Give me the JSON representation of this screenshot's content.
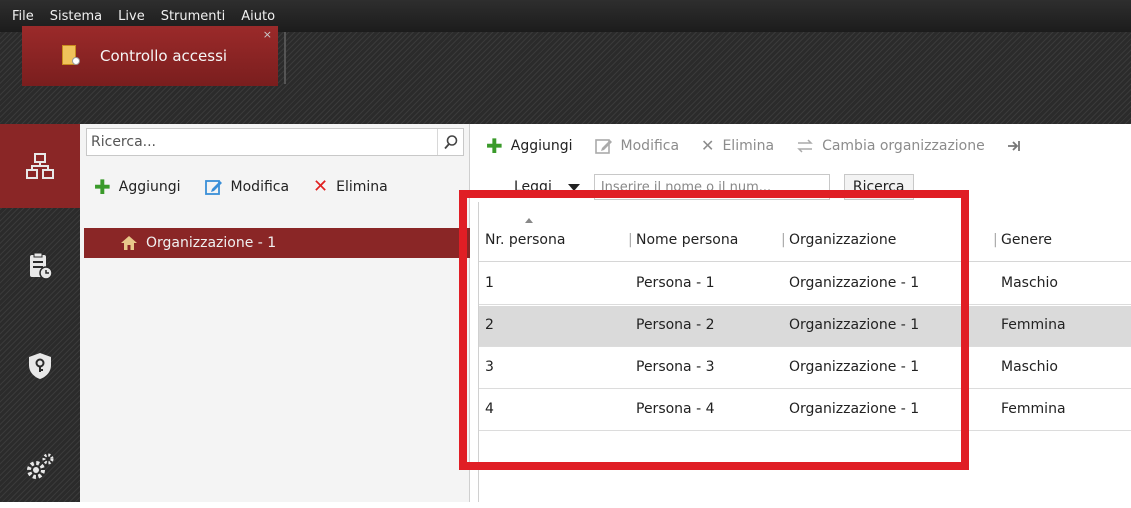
{
  "menu": [
    "File",
    "Sistema",
    "Live",
    "Strumenti",
    "Aiuto"
  ],
  "tab": {
    "label": "Controllo accessi",
    "close": "×"
  },
  "left": {
    "search_placeholder": "Ricerca...",
    "toolbar": {
      "add": "Aggiungi",
      "edit": "Modifica",
      "delete": "Elimina"
    },
    "tree": [
      {
        "label": "Organizzazione - 1"
      }
    ]
  },
  "right": {
    "toolbar": {
      "add": "Aggiungi",
      "edit": "Modifica",
      "delete": "Elimina",
      "change_org": "Cambia organizzazione"
    },
    "filter_label": "Leggi",
    "search_placeholder": "Inserire il nome o il num...",
    "search_button": "Ricerca"
  },
  "table": {
    "columns": [
      "Nr. persona",
      "Nome persona",
      "Organizzazione",
      "Genere"
    ],
    "rows": [
      [
        "1",
        "Persona - 1",
        "Organizzazione - 1",
        "Maschio"
      ],
      [
        "2",
        "Persona - 2",
        "Organizzazione - 1",
        "Femmina"
      ],
      [
        "3",
        "Persona - 3",
        "Organizzazione - 1",
        "Maschio"
      ],
      [
        "4",
        "Persona - 4",
        "Organizzazione - 1",
        "Femmina"
      ]
    ]
  },
  "colors": {
    "accent": "#8a2626",
    "highlight": "#e01e25"
  }
}
